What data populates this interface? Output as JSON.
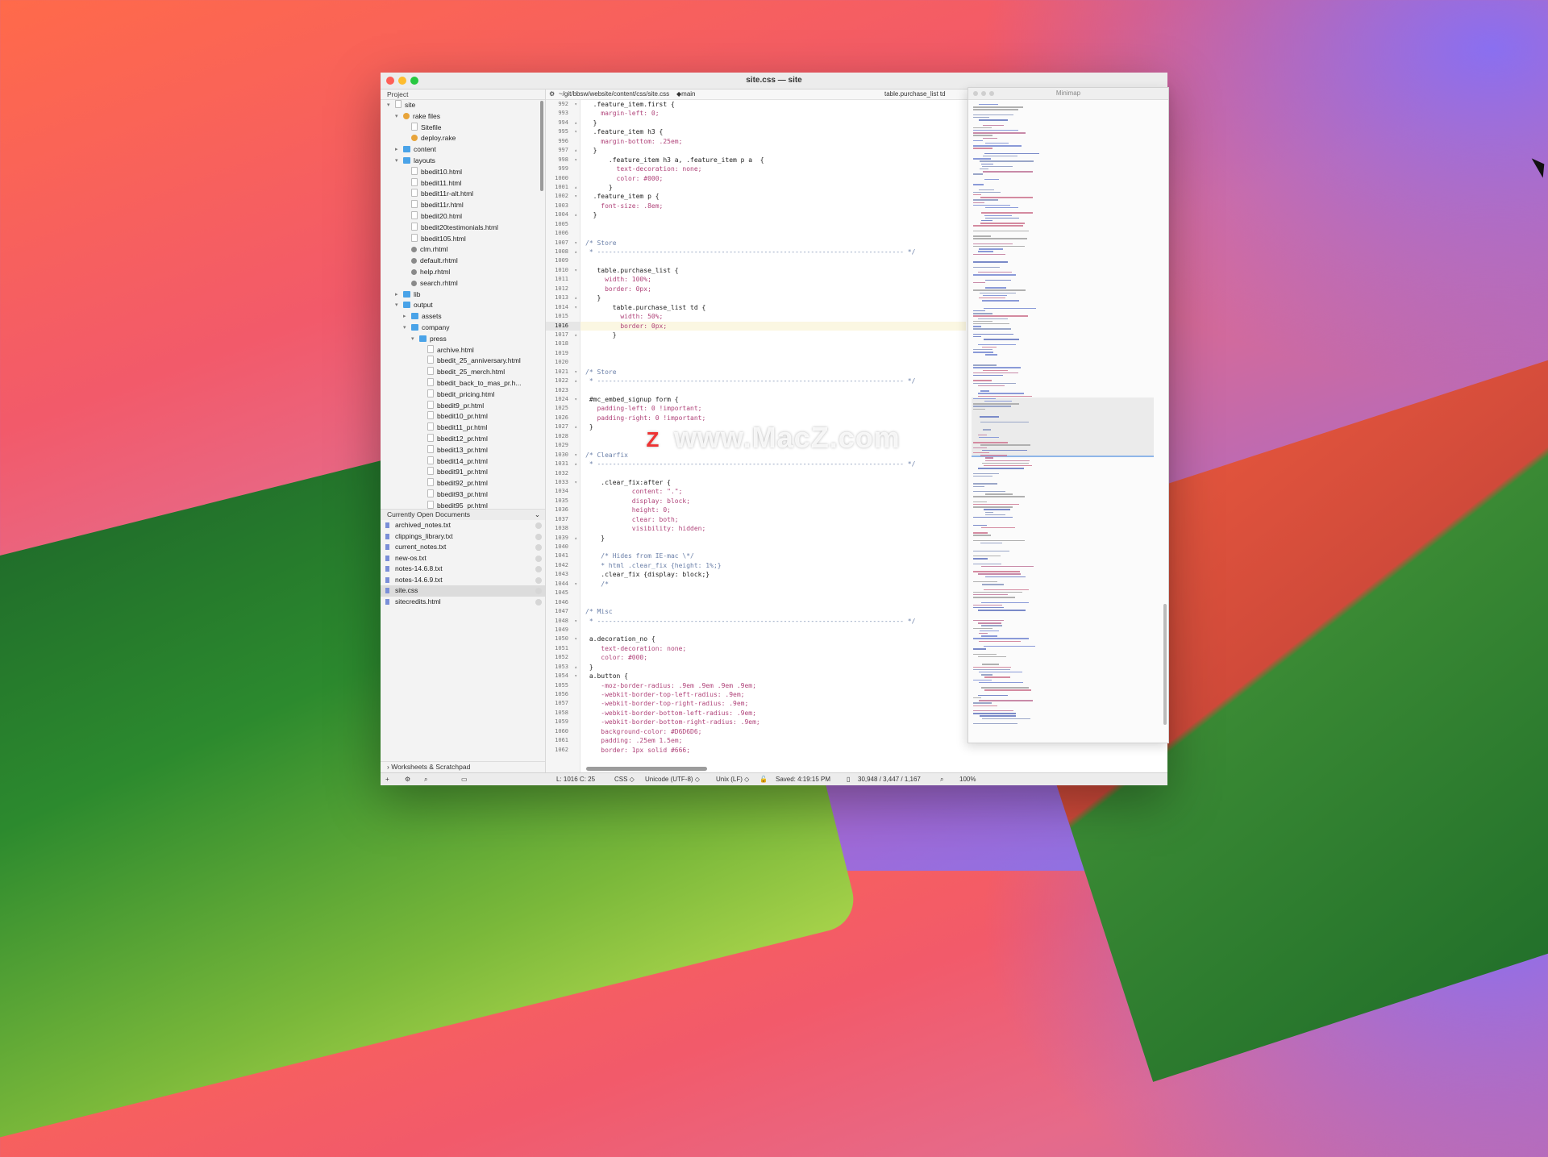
{
  "window": {
    "title": "site.css — site"
  },
  "sidebar": {
    "header": "Project",
    "tree": [
      {
        "label": "site",
        "depth": 0,
        "icon": "file",
        "arrow": "▾"
      },
      {
        "label": "rake files",
        "depth": 1,
        "icon": "rake",
        "arrow": "▾"
      },
      {
        "label": "Sitefile",
        "depth": 2,
        "icon": "file",
        "arrow": ""
      },
      {
        "label": "deploy.rake",
        "depth": 2,
        "icon": "rake",
        "arrow": ""
      },
      {
        "label": "content",
        "depth": 1,
        "icon": "folder",
        "arrow": "▸"
      },
      {
        "label": "layouts",
        "depth": 1,
        "icon": "folder",
        "arrow": "▾"
      },
      {
        "label": "bbedit10.html",
        "depth": 2,
        "icon": "file",
        "arrow": ""
      },
      {
        "label": "bbedit11.html",
        "depth": 2,
        "icon": "file",
        "arrow": ""
      },
      {
        "label": "bbedit11r-alt.html",
        "depth": 2,
        "icon": "file",
        "arrow": ""
      },
      {
        "label": "bbedit11r.html",
        "depth": 2,
        "icon": "file",
        "arrow": ""
      },
      {
        "label": "bbedit20.html",
        "depth": 2,
        "icon": "file",
        "arrow": ""
      },
      {
        "label": "bbedit20testimonials.html",
        "depth": 2,
        "icon": "file",
        "arrow": ""
      },
      {
        "label": "bbedit105.html",
        "depth": 2,
        "icon": "file",
        "arrow": ""
      },
      {
        "label": "clm.rhtml",
        "depth": 2,
        "icon": "gear",
        "arrow": ""
      },
      {
        "label": "default.rhtml",
        "depth": 2,
        "icon": "gear",
        "arrow": ""
      },
      {
        "label": "help.rhtml",
        "depth": 2,
        "icon": "gear",
        "arrow": ""
      },
      {
        "label": "search.rhtml",
        "depth": 2,
        "icon": "gear",
        "arrow": ""
      },
      {
        "label": "lib",
        "depth": 1,
        "icon": "folder",
        "arrow": "▸"
      },
      {
        "label": "output",
        "depth": 1,
        "icon": "folder",
        "arrow": "▾"
      },
      {
        "label": "assets",
        "depth": 2,
        "icon": "folder",
        "arrow": "▸"
      },
      {
        "label": "company",
        "depth": 2,
        "icon": "folder",
        "arrow": "▾"
      },
      {
        "label": "press",
        "depth": 3,
        "icon": "folder",
        "arrow": "▾"
      },
      {
        "label": "archive.html",
        "depth": 4,
        "icon": "file",
        "arrow": ""
      },
      {
        "label": "bbedit_25_anniversary.html",
        "depth": 4,
        "icon": "file",
        "arrow": ""
      },
      {
        "label": "bbedit_25_merch.html",
        "depth": 4,
        "icon": "file",
        "arrow": ""
      },
      {
        "label": "bbedit_back_to_mas_pr.h...",
        "depth": 4,
        "icon": "file",
        "arrow": ""
      },
      {
        "label": "bbedit_pricing.html",
        "depth": 4,
        "icon": "file",
        "arrow": ""
      },
      {
        "label": "bbedit9_pr.html",
        "depth": 4,
        "icon": "file",
        "arrow": ""
      },
      {
        "label": "bbedit10_pr.html",
        "depth": 4,
        "icon": "file",
        "arrow": ""
      },
      {
        "label": "bbedit11_pr.html",
        "depth": 4,
        "icon": "file",
        "arrow": ""
      },
      {
        "label": "bbedit12_pr.html",
        "depth": 4,
        "icon": "file",
        "arrow": ""
      },
      {
        "label": "bbedit13_pr.html",
        "depth": 4,
        "icon": "file",
        "arrow": ""
      },
      {
        "label": "bbedit14_pr.html",
        "depth": 4,
        "icon": "file",
        "arrow": ""
      },
      {
        "label": "bbedit91_pr.html",
        "depth": 4,
        "icon": "file",
        "arrow": ""
      },
      {
        "label": "bbedit92_pr.html",
        "depth": 4,
        "icon": "file",
        "arrow": ""
      },
      {
        "label": "bbedit93_pr.html",
        "depth": 4,
        "icon": "file",
        "arrow": ""
      },
      {
        "label": "bbedit95_pr.html",
        "depth": 4,
        "icon": "file",
        "arrow": ""
      }
    ],
    "open_docs_header": "Currently Open Documents",
    "open_docs": [
      {
        "label": "archived_notes.txt",
        "selected": false
      },
      {
        "label": "clippings_library.txt",
        "selected": false
      },
      {
        "label": "current_notes.txt",
        "selected": false
      },
      {
        "label": "new-os.txt",
        "selected": false
      },
      {
        "label": "notes-14.6.8.txt",
        "selected": false
      },
      {
        "label": "notes-14.6.9.txt",
        "selected": false
      },
      {
        "label": "site.css",
        "selected": true
      },
      {
        "label": "sitecredits.html",
        "selected": false
      }
    ],
    "worksheets": "Worksheets & Scratchpad"
  },
  "navbar": {
    "path": "~/git/bbsw/website/content/css/site.css",
    "branch": "main",
    "symbol": "table.purchase_list td"
  },
  "editor": {
    "current_line": 1016,
    "lines": [
      {
        "n": 992,
        "f": "▾",
        "t": "  .feature_item.first {"
      },
      {
        "n": 993,
        "f": "",
        "t": "    margin-left: 0;"
      },
      {
        "n": 994,
        "f": "▴",
        "t": "  }"
      },
      {
        "n": 995,
        "f": "▾",
        "t": "  .feature_item h3 {"
      },
      {
        "n": 996,
        "f": "",
        "t": "    margin-bottom: .25em;"
      },
      {
        "n": 997,
        "f": "▴",
        "t": "  }"
      },
      {
        "n": 998,
        "f": "▾",
        "t": "      .feature_item h3 a, .feature_item p a  {"
      },
      {
        "n": 999,
        "f": "",
        "t": "        text-decoration: none;"
      },
      {
        "n": 1000,
        "f": "",
        "t": "        color: #000;"
      },
      {
        "n": 1001,
        "f": "▴",
        "t": "      }"
      },
      {
        "n": 1002,
        "f": "▾",
        "t": "  .feature_item p {"
      },
      {
        "n": 1003,
        "f": "",
        "t": "    font-size: .8em;"
      },
      {
        "n": 1004,
        "f": "▴",
        "t": "  }"
      },
      {
        "n": 1005,
        "f": "",
        "t": ""
      },
      {
        "n": 1006,
        "f": "",
        "t": ""
      },
      {
        "n": 1007,
        "f": "▾",
        "t": "/* Store"
      },
      {
        "n": 1008,
        "f": "▴",
        "t": " * ------------------------------------------------------------------------------- */"
      },
      {
        "n": 1009,
        "f": "",
        "t": ""
      },
      {
        "n": 1010,
        "f": "▾",
        "t": "   table.purchase_list {"
      },
      {
        "n": 1011,
        "f": "",
        "t": "     width: 100%;"
      },
      {
        "n": 1012,
        "f": "",
        "t": "     border: 0px;"
      },
      {
        "n": 1013,
        "f": "▴",
        "t": "   }"
      },
      {
        "n": 1014,
        "f": "▾",
        "t": "       table.purchase_list td {"
      },
      {
        "n": 1015,
        "f": "",
        "t": "         width: 50%;"
      },
      {
        "n": 1016,
        "f": "",
        "t": "         border: 0px;"
      },
      {
        "n": 1017,
        "f": "▴",
        "t": "       }"
      },
      {
        "n": 1018,
        "f": "",
        "t": ""
      },
      {
        "n": 1019,
        "f": "",
        "t": ""
      },
      {
        "n": 1020,
        "f": "",
        "t": ""
      },
      {
        "n": 1021,
        "f": "▾",
        "t": "/* Store"
      },
      {
        "n": 1022,
        "f": "▴",
        "t": " * ------------------------------------------------------------------------------- */"
      },
      {
        "n": 1023,
        "f": "",
        "t": ""
      },
      {
        "n": 1024,
        "f": "▾",
        "t": " #mc_embed_signup form {"
      },
      {
        "n": 1025,
        "f": "",
        "t": "   padding-left: 0 !important;"
      },
      {
        "n": 1026,
        "f": "",
        "t": "   padding-right: 0 !important;"
      },
      {
        "n": 1027,
        "f": "▴",
        "t": " }"
      },
      {
        "n": 1028,
        "f": "",
        "t": ""
      },
      {
        "n": 1029,
        "f": "",
        "t": ""
      },
      {
        "n": 1030,
        "f": "▾",
        "t": "/* Clearfix"
      },
      {
        "n": 1031,
        "f": "▴",
        "t": " * ------------------------------------------------------------------------------- */"
      },
      {
        "n": 1032,
        "f": "",
        "t": ""
      },
      {
        "n": 1033,
        "f": "▾",
        "t": "    .clear_fix:after {"
      },
      {
        "n": 1034,
        "f": "",
        "t": "            content: \".\";"
      },
      {
        "n": 1035,
        "f": "",
        "t": "            display: block;"
      },
      {
        "n": 1036,
        "f": "",
        "t": "            height: 0;"
      },
      {
        "n": 1037,
        "f": "",
        "t": "            clear: both;"
      },
      {
        "n": 1038,
        "f": "",
        "t": "            visibility: hidden;"
      },
      {
        "n": 1039,
        "f": "▴",
        "t": "    }"
      },
      {
        "n": 1040,
        "f": "",
        "t": ""
      },
      {
        "n": 1041,
        "f": "",
        "t": "    /* Hides from IE-mac \\*/"
      },
      {
        "n": 1042,
        "f": "",
        "t": "    * html .clear_fix {height: 1%;}"
      },
      {
        "n": 1043,
        "f": "",
        "t": "    .clear_fix {display: block;}"
      },
      {
        "n": 1044,
        "f": "▾",
        "t": "    /*"
      },
      {
        "n": 1045,
        "f": "",
        "t": ""
      },
      {
        "n": 1046,
        "f": "",
        "t": ""
      },
      {
        "n": 1047,
        "f": "",
        "t": "/* Misc"
      },
      {
        "n": 1048,
        "f": "▾",
        "t": " * ------------------------------------------------------------------------------- */"
      },
      {
        "n": 1049,
        "f": "",
        "t": ""
      },
      {
        "n": 1050,
        "f": "▾",
        "t": " a.decoration_no {"
      },
      {
        "n": 1051,
        "f": "",
        "t": "    text-decoration: none;"
      },
      {
        "n": 1052,
        "f": "",
        "t": "    color: #000;"
      },
      {
        "n": 1053,
        "f": "▴",
        "t": " }"
      },
      {
        "n": 1054,
        "f": "▾",
        "t": " a.button {"
      },
      {
        "n": 1055,
        "f": "",
        "t": "    -moz-border-radius: .9em .9em .9em .9em;"
      },
      {
        "n": 1056,
        "f": "",
        "t": "    -webkit-border-top-left-radius: .9em;"
      },
      {
        "n": 1057,
        "f": "",
        "t": "    -webkit-border-top-right-radius: .9em;"
      },
      {
        "n": 1058,
        "f": "",
        "t": "    -webkit-border-bottom-left-radius: .9em;"
      },
      {
        "n": 1059,
        "f": "",
        "t": "    -webkit-border-bottom-right-radius: .9em;"
      },
      {
        "n": 1060,
        "f": "",
        "t": "    background-color: #D6D6D6;"
      },
      {
        "n": 1061,
        "f": "",
        "t": "    padding: .25em 1.5em;"
      },
      {
        "n": 1062,
        "f": "",
        "t": "    border: 1px solid #666;"
      }
    ]
  },
  "minimap": {
    "title": "Minimap"
  },
  "status": {
    "position": "L: 1016 C: 25",
    "language": "CSS ◇",
    "encoding": "Unicode (UTF-8) ◇",
    "line_endings": "Unix (LF) ◇",
    "saved": "Saved: 4:19:15 PM",
    "counts": "30,948 / 3,447 / 1,167",
    "zoom": "100%"
  },
  "watermark": {
    "logo": "Z",
    "text": "www.MacZ.com"
  },
  "colors": {
    "accent": "#4aa3e8",
    "property": "#b0447a",
    "value": "#3a52c4",
    "comment": "#6a7fa8"
  }
}
